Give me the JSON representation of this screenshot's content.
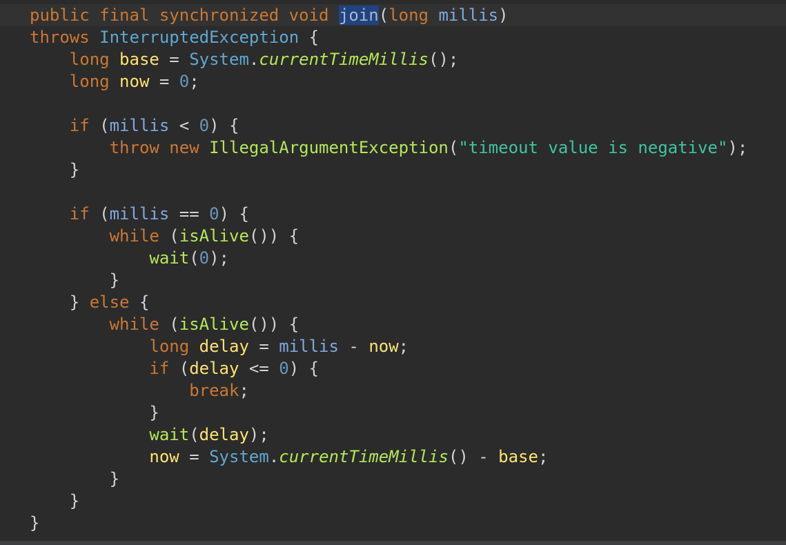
{
  "code_lines": [
    [
      {
        "t": "public final synchronized void ",
        "c": "keyword"
      },
      {
        "t": "join",
        "c": "method-decl"
      },
      {
        "t": "(",
        "c": "punct"
      },
      {
        "t": "long ",
        "c": "keyword"
      },
      {
        "t": "millis",
        "c": "param"
      },
      {
        "t": ")",
        "c": "punct"
      }
    ],
    [
      {
        "t": "throws ",
        "c": "keyword"
      },
      {
        "t": "InterruptedException",
        "c": "class"
      },
      {
        "t": " {",
        "c": "punct"
      }
    ],
    [
      {
        "t": "    ",
        "c": "punct"
      },
      {
        "t": "long ",
        "c": "keyword"
      },
      {
        "t": "base",
        "c": "local"
      },
      {
        "t": " = ",
        "c": "punct"
      },
      {
        "t": "System",
        "c": "class"
      },
      {
        "t": ".",
        "c": "punct"
      },
      {
        "t": "currentTimeMillis",
        "c": "static-method"
      },
      {
        "t": "();",
        "c": "punct"
      }
    ],
    [
      {
        "t": "    ",
        "c": "punct"
      },
      {
        "t": "long ",
        "c": "keyword"
      },
      {
        "t": "now",
        "c": "local"
      },
      {
        "t": " = ",
        "c": "punct"
      },
      {
        "t": "0",
        "c": "number"
      },
      {
        "t": ";",
        "c": "punct"
      }
    ],
    [],
    [
      {
        "t": "    ",
        "c": "punct"
      },
      {
        "t": "if ",
        "c": "keyword"
      },
      {
        "t": "(",
        "c": "punct"
      },
      {
        "t": "millis",
        "c": "param"
      },
      {
        "t": " < ",
        "c": "punct"
      },
      {
        "t": "0",
        "c": "number"
      },
      {
        "t": ") {",
        "c": "punct"
      }
    ],
    [
      {
        "t": "        ",
        "c": "punct"
      },
      {
        "t": "throw new ",
        "c": "keyword"
      },
      {
        "t": "IllegalArgumentException",
        "c": "exception"
      },
      {
        "t": "(",
        "c": "punct"
      },
      {
        "t": "\"timeout value is negative\"",
        "c": "string"
      },
      {
        "t": ");",
        "c": "punct"
      }
    ],
    [
      {
        "t": "    }",
        "c": "punct"
      }
    ],
    [],
    [
      {
        "t": "    ",
        "c": "punct"
      },
      {
        "t": "if ",
        "c": "keyword"
      },
      {
        "t": "(",
        "c": "punct"
      },
      {
        "t": "millis",
        "c": "param"
      },
      {
        "t": " == ",
        "c": "punct"
      },
      {
        "t": "0",
        "c": "number"
      },
      {
        "t": ") {",
        "c": "punct"
      }
    ],
    [
      {
        "t": "        ",
        "c": "punct"
      },
      {
        "t": "while ",
        "c": "keyword"
      },
      {
        "t": "(",
        "c": "punct"
      },
      {
        "t": "isAlive",
        "c": "method"
      },
      {
        "t": "()) {",
        "c": "punct"
      }
    ],
    [
      {
        "t": "            ",
        "c": "punct"
      },
      {
        "t": "wait",
        "c": "method"
      },
      {
        "t": "(",
        "c": "punct"
      },
      {
        "t": "0",
        "c": "number"
      },
      {
        "t": ");",
        "c": "punct"
      }
    ],
    [
      {
        "t": "        }",
        "c": "punct"
      }
    ],
    [
      {
        "t": "    } ",
        "c": "punct"
      },
      {
        "t": "else",
        "c": "keyword"
      },
      {
        "t": " {",
        "c": "punct"
      }
    ],
    [
      {
        "t": "        ",
        "c": "punct"
      },
      {
        "t": "while ",
        "c": "keyword"
      },
      {
        "t": "(",
        "c": "punct"
      },
      {
        "t": "isAlive",
        "c": "method"
      },
      {
        "t": "()) {",
        "c": "punct"
      }
    ],
    [
      {
        "t": "            ",
        "c": "punct"
      },
      {
        "t": "long ",
        "c": "keyword"
      },
      {
        "t": "delay",
        "c": "local"
      },
      {
        "t": " = ",
        "c": "punct"
      },
      {
        "t": "millis",
        "c": "param"
      },
      {
        "t": " - ",
        "c": "punct"
      },
      {
        "t": "now",
        "c": "local"
      },
      {
        "t": ";",
        "c": "punct"
      }
    ],
    [
      {
        "t": "            ",
        "c": "punct"
      },
      {
        "t": "if ",
        "c": "keyword"
      },
      {
        "t": "(",
        "c": "punct"
      },
      {
        "t": "delay",
        "c": "local"
      },
      {
        "t": " <= ",
        "c": "punct"
      },
      {
        "t": "0",
        "c": "number"
      },
      {
        "t": ") {",
        "c": "punct"
      }
    ],
    [
      {
        "t": "                ",
        "c": "punct"
      },
      {
        "t": "break",
        "c": "keyword"
      },
      {
        "t": ";",
        "c": "punct"
      }
    ],
    [
      {
        "t": "            }",
        "c": "punct"
      }
    ],
    [
      {
        "t": "            ",
        "c": "punct"
      },
      {
        "t": "wait",
        "c": "method"
      },
      {
        "t": "(",
        "c": "punct"
      },
      {
        "t": "delay",
        "c": "local"
      },
      {
        "t": ");",
        "c": "punct"
      }
    ],
    [
      {
        "t": "            ",
        "c": "punct"
      },
      {
        "t": "now",
        "c": "local"
      },
      {
        "t": " = ",
        "c": "punct"
      },
      {
        "t": "System",
        "c": "class"
      },
      {
        "t": ".",
        "c": "punct"
      },
      {
        "t": "currentTimeMillis",
        "c": "static-method"
      },
      {
        "t": "() - ",
        "c": "punct"
      },
      {
        "t": "base",
        "c": "local"
      },
      {
        "t": ";",
        "c": "punct"
      }
    ],
    [
      {
        "t": "        }",
        "c": "punct"
      }
    ],
    [
      {
        "t": "    }",
        "c": "punct"
      }
    ],
    [
      {
        "t": "}",
        "c": "punct"
      }
    ]
  ],
  "current_line": 0,
  "colors": {
    "background": "#2b2b2b",
    "current_line": "#323232",
    "keyword": "#cc7832",
    "class": "#5fa8d3",
    "param": "#7fa9e0",
    "local": "#ffe36e",
    "method": "#b5e853",
    "string": "#3cc6a0",
    "number": "#6897bb",
    "selection": "#214283"
  }
}
